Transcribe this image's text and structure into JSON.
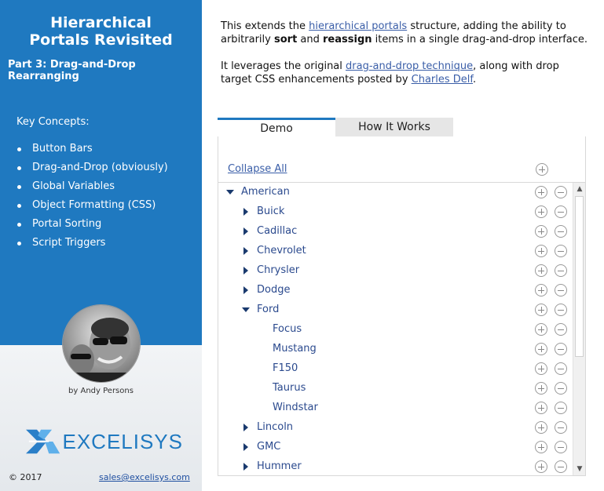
{
  "sidebar": {
    "title": "Hierarchical Portals Revisited",
    "subtitle": "Part 3: Drag-and-Drop Rearranging",
    "concepts_heading": "Key Concepts:",
    "concepts": [
      "Button Bars",
      "Drag-and-Drop (obviously)",
      "Global Variables",
      "Object Formatting (CSS)",
      "Portal Sorting",
      "Script Triggers"
    ],
    "byline": "by Andy Persons",
    "logo_text": "EXCELISYS",
    "copyright": "© 2017",
    "email": "sales@excelisys.com",
    "accent_color": "#1f79c0"
  },
  "intro": {
    "p1_a": "This extends the ",
    "p1_link": "hierarchical portals",
    "p1_b": " structure, adding the ability to arbitrarily ",
    "p1_bold1": "sort",
    "p1_c": " and ",
    "p1_bold2": "reassign",
    "p1_d": " items in a single drag-and-drop interface.",
    "p2_a": "It leverages the original ",
    "p2_link1": "drag-and-drop technique",
    "p2_b": ", along with drop target CSS enhancements posted by ",
    "p2_link2": "Charles Delf",
    "p2_c": "."
  },
  "tabs": {
    "demo": "Demo",
    "how": "How It Works"
  },
  "portal": {
    "collapse_all": "Collapse All",
    "rows": [
      {
        "label": "American",
        "level": 0,
        "state": "expanded"
      },
      {
        "label": "Buick",
        "level": 1,
        "state": "collapsed"
      },
      {
        "label": "Cadillac",
        "level": 1,
        "state": "collapsed"
      },
      {
        "label": "Chevrolet",
        "level": 1,
        "state": "collapsed"
      },
      {
        "label": "Chrysler",
        "level": 1,
        "state": "collapsed"
      },
      {
        "label": "Dodge",
        "level": 1,
        "state": "collapsed"
      },
      {
        "label": "Ford",
        "level": 1,
        "state": "expanded"
      },
      {
        "label": "Focus",
        "level": 2,
        "state": "leaf"
      },
      {
        "label": "Mustang",
        "level": 2,
        "state": "leaf"
      },
      {
        "label": "F150",
        "level": 2,
        "state": "leaf"
      },
      {
        "label": "Taurus",
        "level": 2,
        "state": "leaf"
      },
      {
        "label": "Windstar",
        "level": 2,
        "state": "leaf"
      },
      {
        "label": "Lincoln",
        "level": 1,
        "state": "collapsed"
      },
      {
        "label": "GMC",
        "level": 1,
        "state": "collapsed"
      },
      {
        "label": "Hummer",
        "level": 1,
        "state": "collapsed"
      }
    ],
    "add_icon": "add-circle-icon",
    "remove_icon": "remove-circle-icon"
  }
}
